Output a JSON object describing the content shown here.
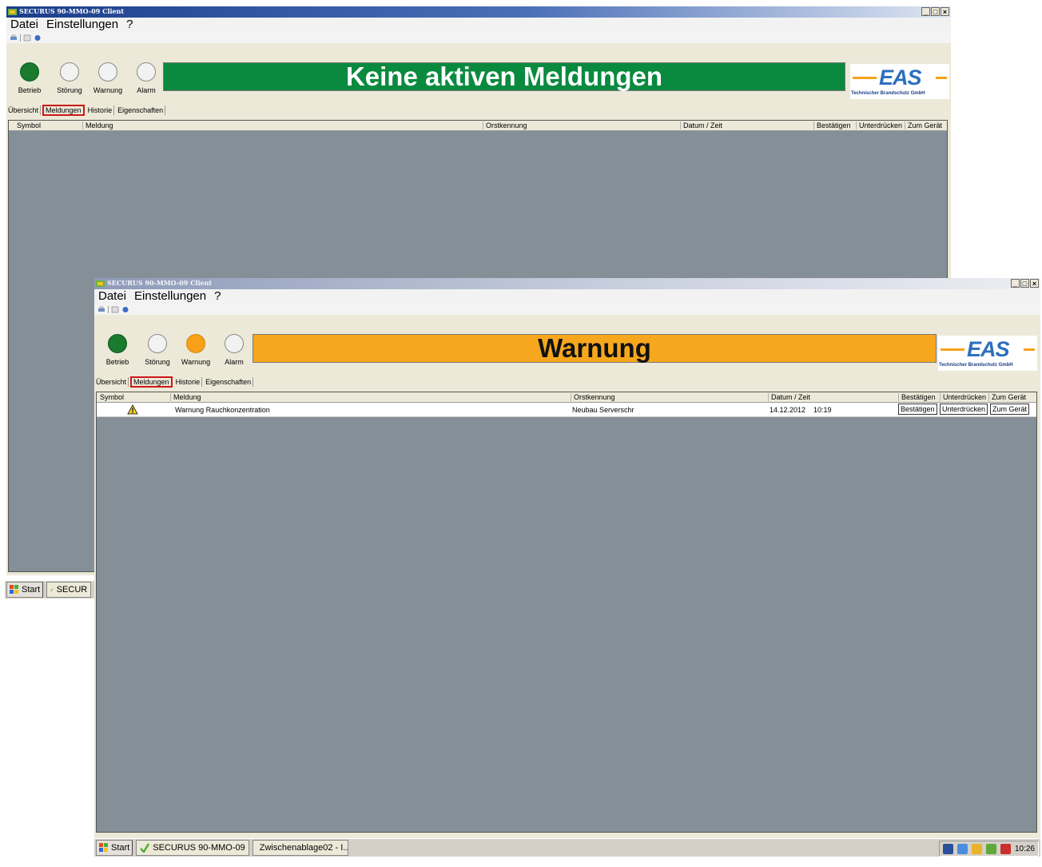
{
  "window_back": {
    "title": "SECURUS 90-MMO-09 Client",
    "menu": [
      "Datei",
      "Einstellungen",
      "?"
    ],
    "lamps": [
      {
        "label": "Betrieb",
        "state": "green"
      },
      {
        "label": "Störung",
        "state": "off"
      },
      {
        "label": "Warnung",
        "state": "off"
      },
      {
        "label": "Alarm",
        "state": "off"
      }
    ],
    "banner": "Keine aktiven Meldungen",
    "banner_color": "#0a8a3e",
    "tabs": [
      "Übersicht",
      "Meldungen",
      "Historie",
      "Eigenschaften"
    ],
    "active_tab": "Meldungen",
    "columns": [
      "Symbol",
      "Meldung",
      "Orstkennung",
      "Datum / Zeit",
      "Bestätigen",
      "Unterdrücken",
      "Zum Gerät"
    ],
    "taskbar": {
      "start": "Start",
      "task": "SECUR"
    }
  },
  "window_front": {
    "title": "SECURUS 90-MMO-09 Client",
    "menu": [
      "Datei",
      "Einstellungen",
      "?"
    ],
    "lamps": [
      {
        "label": "Betrieb",
        "state": "green"
      },
      {
        "label": "Störung",
        "state": "off"
      },
      {
        "label": "Warnung",
        "state": "orange"
      },
      {
        "label": "Alarm",
        "state": "off"
      }
    ],
    "banner": "Warnung",
    "banner_color": "#f7a71d",
    "tabs": [
      "Übersicht",
      "Meldungen",
      "Historie",
      "Eigenschaften"
    ],
    "active_tab": "Meldungen",
    "columns": [
      "Symbol",
      "Meldung",
      "Orstkennung",
      "Datum / Zeit",
      "Bestätigen",
      "Unterdrücken",
      "Zum Gerät"
    ],
    "rows": [
      {
        "symbol": "warning-icon",
        "meldung": "Warnung Rauchkonzentration",
        "ort": "Neubau Serverschr",
        "datum": "14.12.2012",
        "zeit": "10:19",
        "btn_confirm": "Bestätigen",
        "btn_suppress": "Unterdrücken",
        "btn_goto": "Zum Gerät"
      }
    ],
    "taskbar": {
      "start": "Start",
      "task1": "SECURUS 90-MMO-09",
      "task2": "Zwischenablage02 - I...",
      "clock": "10:26"
    }
  },
  "logo": {
    "text": "EAS",
    "subtitle": "Technischer Brandschutz GmbH"
  },
  "colors": {
    "accent_green": "#1a7a2e",
    "accent_orange": "#f7a018",
    "highlight_red": "#cc1818"
  }
}
